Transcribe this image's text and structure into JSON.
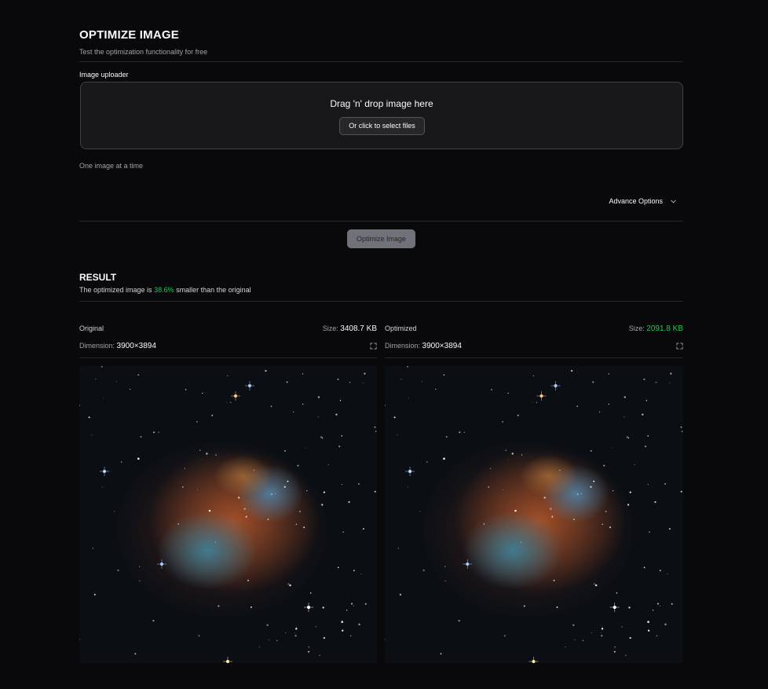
{
  "header": {
    "title": "OPTIMIZE IMAGE",
    "subtitle": "Test the optimization functionality for free"
  },
  "uploader": {
    "label": "Image uploader",
    "drop_text": "Drag 'n' drop image here",
    "select_button": "Or click to select files",
    "hint": "One image at a time"
  },
  "advanced": {
    "label": "Advance Options",
    "icon": "chevron-down-icon"
  },
  "optimize_button": "Optimize Image",
  "result": {
    "title": "RESULT",
    "summary_prefix": "The optimized image is",
    "percent": "38.6%",
    "summary_suffix": "smaller than the original",
    "accent_color": "#22c55e"
  },
  "original": {
    "name": "Original",
    "size_label": "Size:",
    "size": "3408.7 KB",
    "dimension_label": "Dimension:",
    "dimension": "3900×3894",
    "expand_icon": "expand-icon"
  },
  "optimized": {
    "name": "Optimized",
    "size_label": "Size:",
    "size": "2091.8 KB",
    "dimension_label": "Dimension:",
    "dimension": "3900×3894",
    "expand_icon": "expand-icon"
  }
}
